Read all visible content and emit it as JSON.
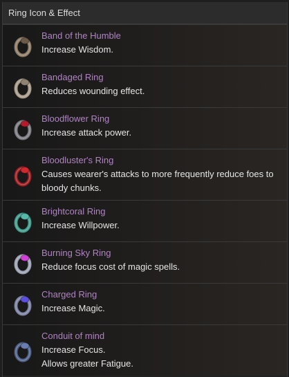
{
  "header": {
    "title": "Ring Icon & Effect"
  },
  "rings": [
    {
      "name": "Band of the Humble",
      "desc": "Increase Wisdom.",
      "icon": "band-of-the-humble-icon",
      "band": "#8c7a66",
      "gem": "#6b5a48"
    },
    {
      "name": "Bandaged Ring",
      "desc": "Reduces wounding effect.",
      "icon": "bandaged-ring-icon",
      "band": "#a59a88",
      "gem": "#8e8373"
    },
    {
      "name": "Bloodflower Ring",
      "desc": "Increase attack power.",
      "icon": "bloodflower-ring-icon",
      "band": "#7a7a80",
      "gem": "#b51b2a"
    },
    {
      "name": "Bloodluster's Ring",
      "desc": "Causes wearer's attacks to more frequently reduce foes to bloody chunks.",
      "icon": "bloodlusters-ring-icon",
      "band": "#9c1d22",
      "gem": "#d0282f"
    },
    {
      "name": "Brightcoral Ring",
      "desc": "Increase Willpower.",
      "icon": "brightcoral-ring-icon",
      "band": "#3f9a8a",
      "gem": "#56b8a6"
    },
    {
      "name": "Burning Sky Ring",
      "desc": "Reduce focus cost of magic spells.",
      "icon": "burning-sky-ring-icon",
      "band": "#9aa0b0",
      "gem": "#d13fd6"
    },
    {
      "name": "Charged Ring",
      "desc": "Increase Magic.",
      "icon": "charged-ring-icon",
      "band": "#7a80a0",
      "gem": "#5c4fe0"
    },
    {
      "name": "Conduit of mind",
      "desc": "Increase Focus.\nAllows greater Fatigue.",
      "icon": "conduit-of-mind-icon",
      "band": "#4d5f86",
      "gem": "#6a7db0"
    }
  ]
}
